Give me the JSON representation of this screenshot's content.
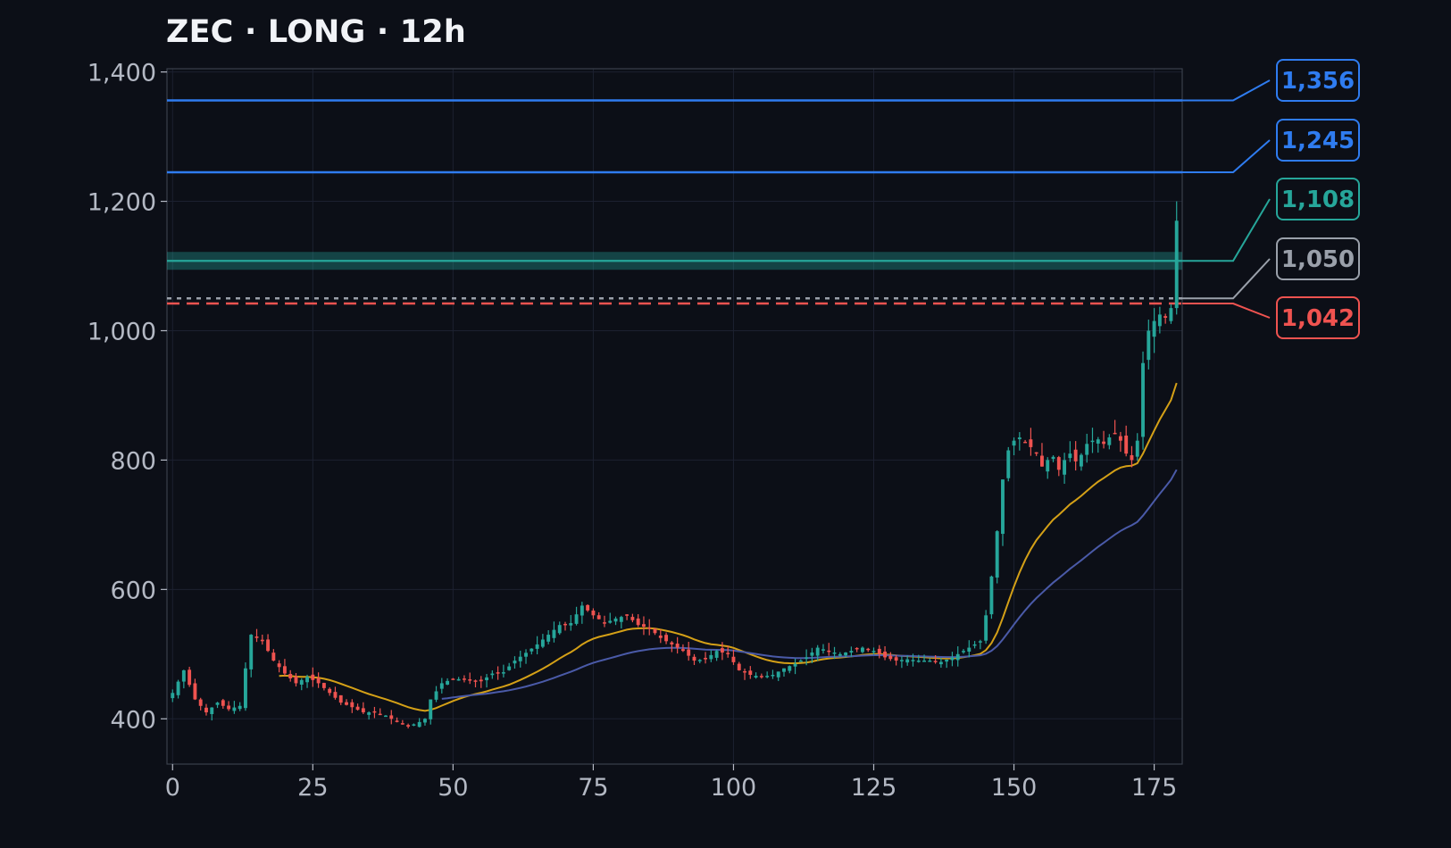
{
  "title": "ZEC · LONG · 12h",
  "colors": {
    "background": "#0c0f17",
    "up": "#26a69a",
    "down": "#ef5350",
    "target": "#2f7cf0",
    "take_profit": "#26a69a",
    "entry": "#9aa0aa",
    "stop": "#ef5350",
    "ema_fast": "#d4a017",
    "ema_slow": "#4a5aa8",
    "grid": "#1c2130",
    "axis": "#3a404c",
    "tick": "#b4b9c4"
  },
  "chart_data": {
    "type": "candlestick",
    "title": "ZEC · LONG · 12h",
    "xlim": [
      -1,
      180
    ],
    "ylim": [
      330,
      1405
    ],
    "x_ticks": [
      0,
      25,
      50,
      75,
      100,
      125,
      150,
      175
    ],
    "x_tick_labels": [
      "0",
      "25",
      "50",
      "75",
      "100",
      "125",
      "150",
      "175"
    ],
    "y_ticks": [
      400,
      600,
      800,
      1000,
      1200,
      1400
    ],
    "y_tick_labels": [
      "400",
      "600",
      "800",
      "1,000",
      "1,200",
      "1,400"
    ],
    "grid": true,
    "close_anchors": [
      [
        0,
        440
      ],
      [
        2,
        475
      ],
      [
        4,
        430
      ],
      [
        6,
        410
      ],
      [
        8,
        425
      ],
      [
        10,
        415
      ],
      [
        12,
        420
      ],
      [
        13,
        478
      ],
      [
        14,
        530
      ],
      [
        16,
        520
      ],
      [
        18,
        490
      ],
      [
        20,
        470
      ],
      [
        22,
        455
      ],
      [
        24,
        465
      ],
      [
        26,
        455
      ],
      [
        28,
        440
      ],
      [
        30,
        425
      ],
      [
        32,
        418
      ],
      [
        34,
        410
      ],
      [
        36,
        410
      ],
      [
        38,
        405
      ],
      [
        40,
        395
      ],
      [
        42,
        388
      ],
      [
        44,
        395
      ],
      [
        45,
        400
      ],
      [
        46,
        430
      ],
      [
        48,
        455
      ],
      [
        50,
        462
      ],
      [
        53,
        460
      ],
      [
        55,
        458
      ],
      [
        57,
        470
      ],
      [
        59,
        472
      ],
      [
        61,
        490
      ],
      [
        63,
        502
      ],
      [
        65,
        515
      ],
      [
        67,
        530
      ],
      [
        69,
        545
      ],
      [
        71,
        548
      ],
      [
        73,
        575
      ],
      [
        75,
        560
      ],
      [
        77,
        548
      ],
      [
        79,
        555
      ],
      [
        81,
        560
      ],
      [
        83,
        545
      ],
      [
        85,
        540
      ],
      [
        87,
        525
      ],
      [
        89,
        515
      ],
      [
        91,
        505
      ],
      [
        93,
        490
      ],
      [
        95,
        492
      ],
      [
        97,
        505
      ],
      [
        99,
        500
      ],
      [
        101,
        475
      ],
      [
        103,
        468
      ],
      [
        105,
        465
      ],
      [
        107,
        468
      ],
      [
        109,
        478
      ],
      [
        111,
        485
      ],
      [
        113,
        495
      ],
      [
        115,
        510
      ],
      [
        117,
        505
      ],
      [
        119,
        500
      ],
      [
        121,
        505
      ],
      [
        123,
        510
      ],
      [
        125,
        505
      ],
      [
        127,
        495
      ],
      [
        129,
        490
      ],
      [
        131,
        492
      ],
      [
        133,
        490
      ],
      [
        135,
        490
      ],
      [
        137,
        488
      ],
      [
        139,
        495
      ],
      [
        141,
        505
      ],
      [
        143,
        515
      ],
      [
        144,
        520
      ],
      [
        145,
        560
      ],
      [
        146,
        620
      ],
      [
        147,
        690
      ],
      [
        148,
        770
      ],
      [
        149,
        815
      ],
      [
        150,
        830
      ],
      [
        151,
        835
      ],
      [
        152,
        828
      ],
      [
        153,
        820
      ],
      [
        154,
        810
      ],
      [
        155,
        790
      ],
      [
        156,
        800
      ],
      [
        157,
        805
      ],
      [
        158,
        785
      ],
      [
        159,
        800
      ],
      [
        160,
        810
      ],
      [
        161,
        798
      ],
      [
        162,
        808
      ],
      [
        163,
        825
      ],
      [
        164,
        830
      ],
      [
        165,
        832
      ],
      [
        166,
        825
      ],
      [
        167,
        835
      ],
      [
        168,
        840
      ],
      [
        169,
        830
      ],
      [
        170,
        810
      ],
      [
        171,
        800
      ],
      [
        172,
        830
      ],
      [
        173,
        950
      ],
      [
        174,
        1000
      ],
      [
        175,
        1015
      ],
      [
        176,
        1025
      ],
      [
        177,
        1020
      ],
      [
        178,
        1035
      ],
      [
        179,
        1170
      ]
    ],
    "overlay_lines": [
      {
        "label": "1,356",
        "value": 1356,
        "role": "target",
        "style": "solid"
      },
      {
        "label": "1,245",
        "value": 1245,
        "role": "target",
        "style": "solid"
      },
      {
        "label": "1,108",
        "value": 1108,
        "role": "take_profit",
        "style": "band"
      },
      {
        "label": "1,050",
        "value": 1050,
        "role": "entry",
        "style": "dotted"
      },
      {
        "label": "1,042",
        "value": 1042,
        "role": "stop",
        "style": "dashed"
      }
    ],
    "moving_averages": [
      {
        "role": "ema_fast",
        "period": 20
      },
      {
        "role": "ema_slow",
        "period": 50
      }
    ]
  }
}
